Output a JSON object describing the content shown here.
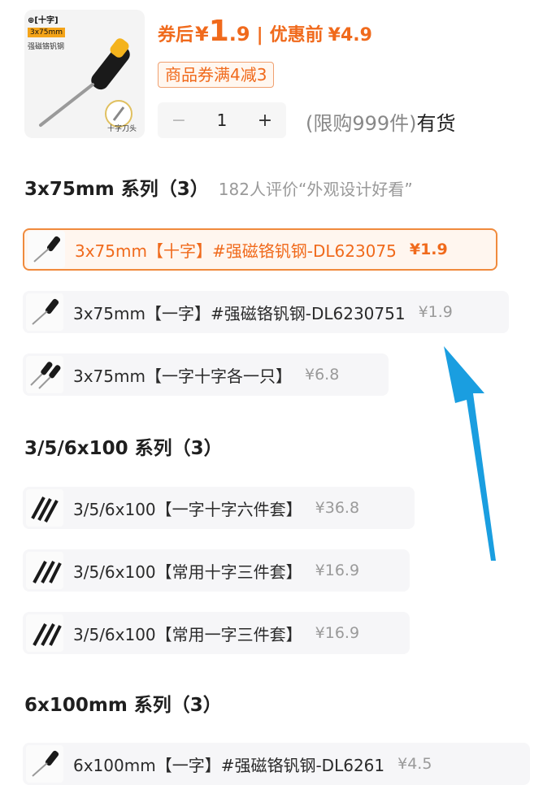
{
  "product": {
    "thumb_tag": "⊕[十字]",
    "thumb_size": "3x75mm",
    "thumb_material": "强磁铬钒钢",
    "thumb_caption": "十字刀头",
    "after_coupon_label": "券后",
    "currency": "¥",
    "after_coupon_int": "1",
    "after_coupon_dec": ".9",
    "before_label": "优惠前",
    "before_price": "¥4.9",
    "coupon_text": "商品券满4减3"
  },
  "stepper": {
    "minus": "−",
    "quantity": "1",
    "plus": "+"
  },
  "stock": {
    "limit": "(限购999件)",
    "status": "有货"
  },
  "sections": [
    {
      "title": "3x75mm 系列（3）",
      "note": "182人评价“外观设计好看”",
      "options": [
        {
          "label": "3x75mm【十字】#强磁铬钒钢-DL623075",
          "price": "¥1.9",
          "selected": true
        },
        {
          "label": "3x75mm【一字】#强磁铬钒钢-DL6230751",
          "price": "¥1.9",
          "selected": false
        },
        {
          "label": "3x75mm【一字十字各一只】",
          "price": "¥6.8",
          "selected": false
        }
      ]
    },
    {
      "title": "3/5/6x100 系列（3）",
      "note": "",
      "options": [
        {
          "label": "3/5/6x100【一字十字六件套】",
          "price": "¥36.8",
          "selected": false
        },
        {
          "label": "3/5/6x100【常用十字三件套】",
          "price": "¥16.9",
          "selected": false
        },
        {
          "label": "3/5/6x100【常用一字三件套】",
          "price": "¥16.9",
          "selected": false
        }
      ]
    },
    {
      "title": "6x100mm 系列（3）",
      "note": "",
      "options": [
        {
          "label": "6x100mm【一字】#强磁铬钒钢-DL6261",
          "price": "¥4.5",
          "selected": false
        }
      ]
    }
  ],
  "colors": {
    "accent": "#f06a1c",
    "arrow": "#1a9ee0"
  }
}
